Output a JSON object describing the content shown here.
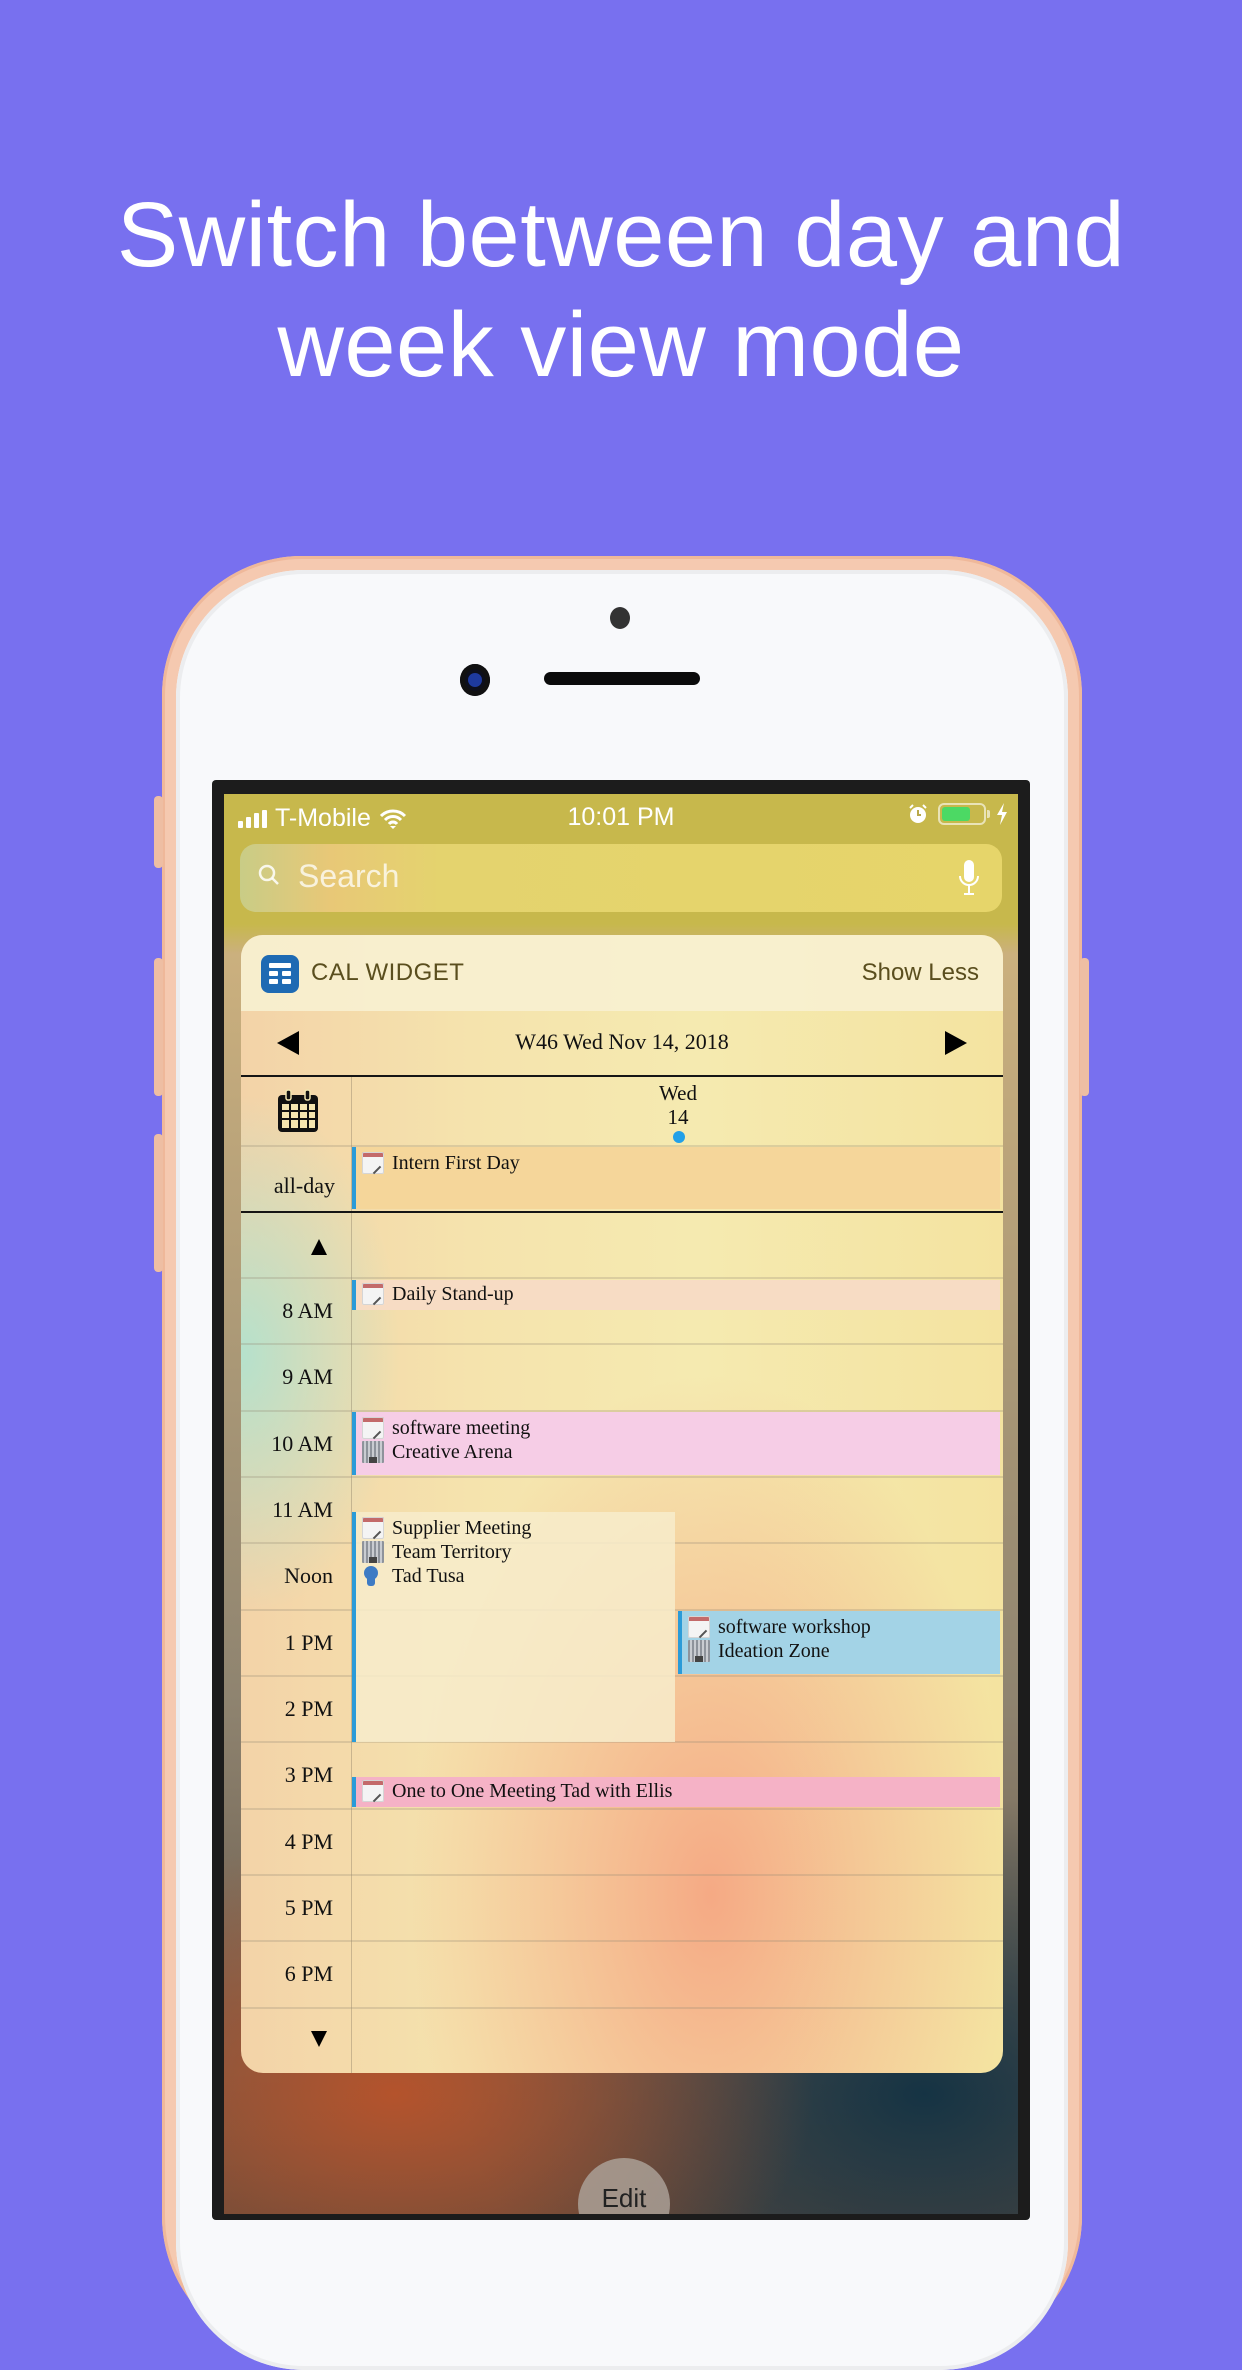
{
  "headline": {
    "line1": "Switch between day and",
    "line2": "week view mode"
  },
  "status_bar": {
    "carrier": "T-Mobile",
    "time": "10:01 PM",
    "icons": [
      "signal-icon",
      "wifi-icon",
      "alarm-icon",
      "battery-icon",
      "charging-icon"
    ],
    "battery_level_fraction": 0.6,
    "battery_color": "#4cd964"
  },
  "search": {
    "placeholder": "Search"
  },
  "widget": {
    "app_name": "CAL WIDGET",
    "app_icon_color": "#1e6ab3",
    "show_less_label": "Show Less",
    "nav_title": "W46 Wed Nov 14, 2018",
    "day_name": "Wed",
    "day_number": "14",
    "today_dot_color": "#22a0e8",
    "allday_label": "all-day",
    "time_labels": [
      "8 AM",
      "9 AM",
      "10 AM",
      "11 AM",
      "Noon",
      "1 PM",
      "2 PM",
      "3 PM",
      "4 PM",
      "5 PM",
      "6 PM"
    ],
    "events": {
      "intern": {
        "title": "Intern First Day",
        "color": "#f5d69a"
      },
      "standup": {
        "title": "Daily Stand-up",
        "color": "#f7dcc4"
      },
      "software_meeting": {
        "title": "software meeting",
        "location": "Creative Arena",
        "color": "#f6cde6"
      },
      "supplier": {
        "title": "Supplier Meeting",
        "location": "Team Territory",
        "attendee": "Tad Tusa",
        "color": "#f7eccb"
      },
      "workshop": {
        "title": "software workshop",
        "location": "Ideation Zone",
        "color": "#a3d3e6"
      },
      "one_to_one": {
        "title": "One to One Meeting Tad with Ellis",
        "color": "#f5b2c6"
      }
    },
    "accent_color": "#2b9bd8"
  },
  "edit_button": {
    "label": "Edit"
  }
}
